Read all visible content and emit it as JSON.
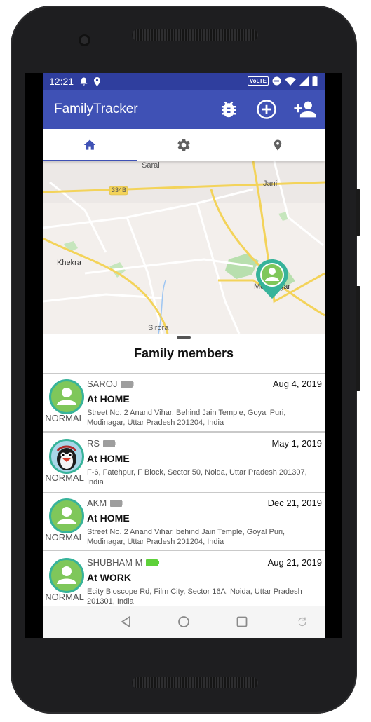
{
  "status_bar": {
    "time": "12:21",
    "volte": "VoLTE"
  },
  "app": {
    "title": "FamilyTracker"
  },
  "toolbar_icons": [
    "bug-icon",
    "add-circle-icon",
    "person-add-icon"
  ],
  "tabs": [
    {
      "icon": "home-icon",
      "selected": true
    },
    {
      "icon": "gear-icon",
      "selected": false
    },
    {
      "icon": "location-pin-icon",
      "selected": false
    }
  ],
  "map": {
    "labels": {
      "sarai": "Sarai",
      "road_334b": "334B",
      "jani": "Jani",
      "khekra": "Khekra",
      "modinagar": "Modinagar",
      "sirora": "Sirora"
    }
  },
  "sheet": {
    "title": "Family members"
  },
  "members": [
    {
      "name": "SAROJ",
      "battery": "low",
      "date": "Aug 4, 2019",
      "state": "NORMAL",
      "place": "At HOME",
      "address": "Street No. 2 Anand Vihar, Behind Jain Temple, Goyal Puri, Modinagar, Uttar Pradesh 201204, India",
      "avatar": "person-avatar"
    },
    {
      "name": "RS",
      "battery": "low",
      "date": "May 1, 2019",
      "state": "NORMAL",
      "place": "At HOME",
      "address": "F-6, Fatehpur, F Block, Sector 50, Noida, Uttar Pradesh 201307, India",
      "avatar": "penguin-avatar"
    },
    {
      "name": "AKM",
      "battery": "low",
      "date": "Dec 21, 2019",
      "state": "NORMAL",
      "place": "At HOME",
      "address": "Street No. 2 Anand Vihar, behind Jain Temple, Goyal Puri, Modinagar, Uttar Pradesh 201204, India",
      "avatar": "person-avatar"
    },
    {
      "name": "SHUBHAM M",
      "battery": "full",
      "date": "Aug 21, 2019",
      "state": "NORMAL",
      "place": "At WORK",
      "address": "Ecity Bioscope Rd, Film City, Sector 16A, Noida, Uttar Pradesh 201301, India",
      "avatar": "person-avatar"
    }
  ],
  "colors": {
    "primary": "#3f51b5",
    "status_bar": "#2f3e9e",
    "avatar_ring": "#37b39a",
    "avatar_fill": "#7fc75a",
    "battery_full": "#5ed13a",
    "battery_low": "#9e9e9e"
  },
  "nav_icons": [
    "back-icon",
    "home-circle-icon",
    "recents-icon",
    "rotate-icon"
  ]
}
